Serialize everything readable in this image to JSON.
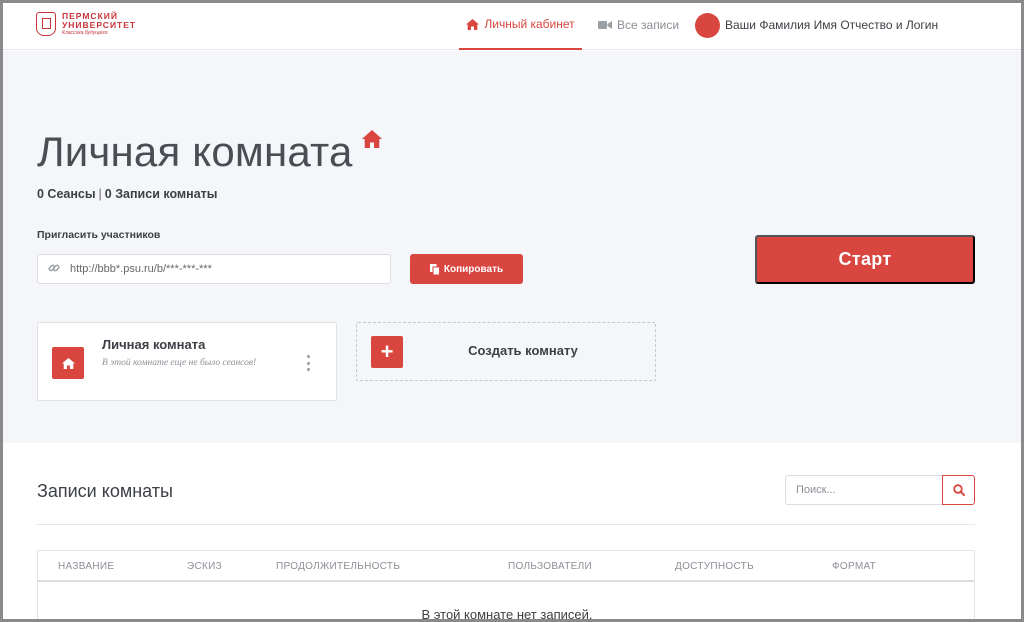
{
  "logo": {
    "line1": "ПЕРМСКИЙ",
    "line2": "УНИВЕРСИТЕТ",
    "line3": "Классика будущего"
  },
  "nav": {
    "home_label": "Личный кабинет",
    "records_label": "Все записи",
    "user_label": "Ваши Фамилия Имя Отчество и Логин"
  },
  "room": {
    "title": "Личная комната",
    "sessions": "0 Сеансы",
    "separator": "|",
    "recordings": "0 Записи комнаты",
    "invite_label": "Пригласить участников",
    "invite_url": "http://bbb*.psu.ru/b/***-***-***",
    "copy_label": "Копировать",
    "start_label": "Старт"
  },
  "room_card": {
    "name": "Личная комната",
    "description": "В этой комнате еще не было сеансов!"
  },
  "create_card": {
    "label": "Создать комнату",
    "plus": "+"
  },
  "records": {
    "title": "Записи комнаты",
    "search_placeholder": "Поиск...",
    "columns": [
      "Название",
      "Эскиз",
      "Продолжительность",
      "Пользователи",
      "Доступность",
      "Формат"
    ],
    "empty_text": "В этой комнате нет записей."
  },
  "colors": {
    "accent": "#d9453f",
    "hero_bg": "#f5f6f9",
    "text": "#3c3f45",
    "muted": "#8b8f96"
  },
  "icons": {
    "nav_home": "home-icon",
    "nav_records": "video-camera-icon",
    "title": "home-icon",
    "invite": "link-icon",
    "copy": "copy-icon",
    "room": "home-icon",
    "menu": "kebab-menu-icon",
    "search": "search-icon"
  }
}
